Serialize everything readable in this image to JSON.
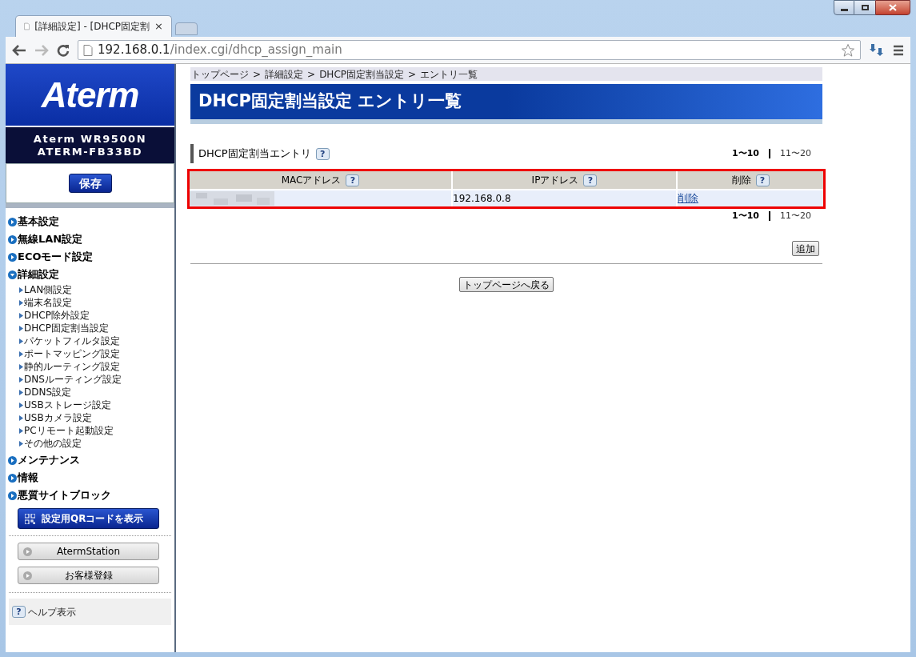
{
  "browser": {
    "tabs": [
      {
        "title": "[詳細設定] - [DHCP固定割",
        "selected": true,
        "close": "×"
      },
      {
        "selected": false
      }
    ],
    "url_host": "192.168.0.1",
    "url_path": "/index.cgi/dhcp_assign_main"
  },
  "sidebar": {
    "logo": "Aterm",
    "model": "Aterm WR9500N",
    "device_name": "ATERM-FB33BD",
    "save_button": "保存",
    "menu": [
      {
        "label": "基本設定",
        "expanded": false
      },
      {
        "label": "無線LAN設定",
        "expanded": false
      },
      {
        "label": "ECOモード設定",
        "expanded": false
      },
      {
        "label": "詳細設定",
        "expanded": true,
        "children": [
          {
            "label": "LAN側設定"
          },
          {
            "label": "端末名設定"
          },
          {
            "label": "DHCP除外設定"
          },
          {
            "label": "DHCP固定割当設定"
          },
          {
            "label": "パケットフィルタ設定"
          },
          {
            "label": "ポートマッピング設定"
          },
          {
            "label": "静的ルーティング設定"
          },
          {
            "label": "DNSルーティング設定"
          },
          {
            "label": "DDNS設定"
          },
          {
            "label": "USBストレージ設定"
          },
          {
            "label": "USBカメラ設定"
          },
          {
            "label": "PCリモート起動設定"
          },
          {
            "label": "その他の設定"
          }
        ]
      },
      {
        "label": "メンテナンス",
        "expanded": false
      },
      {
        "label": "情報",
        "expanded": false
      },
      {
        "label": "悪質サイトブロック",
        "expanded": false
      }
    ],
    "qr_button": "設定用QRコードを表示",
    "link_buttons": [
      "AtermStation",
      "お客様登録"
    ],
    "help": {
      "icon": "?",
      "label": "ヘルプ表示"
    }
  },
  "main": {
    "breadcrumb": [
      "トップページ",
      "詳細設定",
      "DHCP固定割当設定",
      "エントリ一覧"
    ],
    "breadcrumb_separator": ">",
    "title": "DHCP固定割当設定 エントリ一覧",
    "section": {
      "title": "DHCP固定割当エントリ",
      "help": "?"
    },
    "pager_top": [
      {
        "label": "1〜10",
        "selected": true
      },
      {
        "label": "11〜20",
        "selected": false
      }
    ],
    "table": {
      "highlighted": true,
      "columns": [
        {
          "label": "MACアドレス",
          "help": "?"
        },
        {
          "label": "IPアドレス",
          "help": "?"
        },
        {
          "label": "削除",
          "help": "?"
        }
      ],
      "rows": [
        {
          "mac_redacted": true,
          "ip": "192.168.0.8",
          "action": "削除"
        }
      ]
    },
    "pager_bottom": [
      {
        "label": "1〜10",
        "selected": true
      },
      {
        "label": "11〜20",
        "selected": false
      }
    ],
    "add_button": "追加",
    "back_button": "トップページへ戻る"
  }
}
